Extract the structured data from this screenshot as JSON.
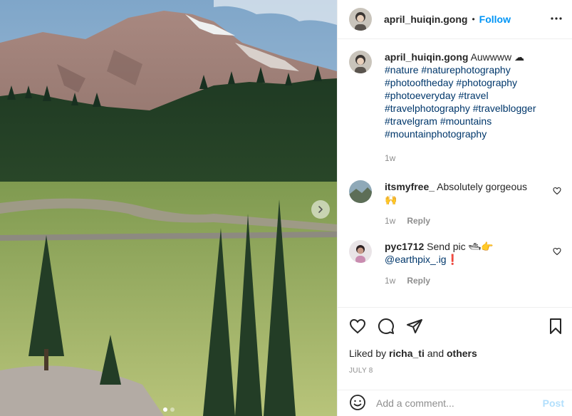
{
  "photo": {
    "description_icon": "next-arrow-icon",
    "carousel_count": 2,
    "carousel_active": 1
  },
  "header": {
    "username": "april_huiqin.gong",
    "separator": "•",
    "follow": "Follow",
    "more_icon": "more-horizontal-icon"
  },
  "caption": {
    "username": "april_huiqin.gong",
    "text": "Auwwww",
    "emoji": "☁",
    "hashtags": [
      "#nature",
      "#naturephotography",
      "#photooftheday",
      "#photography",
      "#photoeveryday",
      "#travel",
      "#travelphotography",
      "#travelblogger",
      "#travelgram",
      "#mountains",
      "#mountainphotography"
    ],
    "time": "1w"
  },
  "comments": [
    {
      "username": "itsmyfree_",
      "text": "Absolutely gorgeous 🙌",
      "time": "1w",
      "reply": "Reply"
    },
    {
      "username": "pyc1712",
      "text": "Send pic 🛥👉",
      "mention": "@earthpix_.ig",
      "mention_suffix": "❗",
      "time": "1w",
      "reply": "Reply"
    }
  ],
  "actions": {
    "like_icon": "heart-icon",
    "comment_icon": "comment-icon",
    "share_icon": "share-icon",
    "save_icon": "bookmark-icon"
  },
  "likes": {
    "prefix": "Liked by",
    "user": "richa_ti",
    "middle": "and",
    "others": "others"
  },
  "date": "JULY 8",
  "add_comment": {
    "placeholder": "Add a comment...",
    "post": "Post",
    "emoji_icon": "smiley-icon"
  }
}
